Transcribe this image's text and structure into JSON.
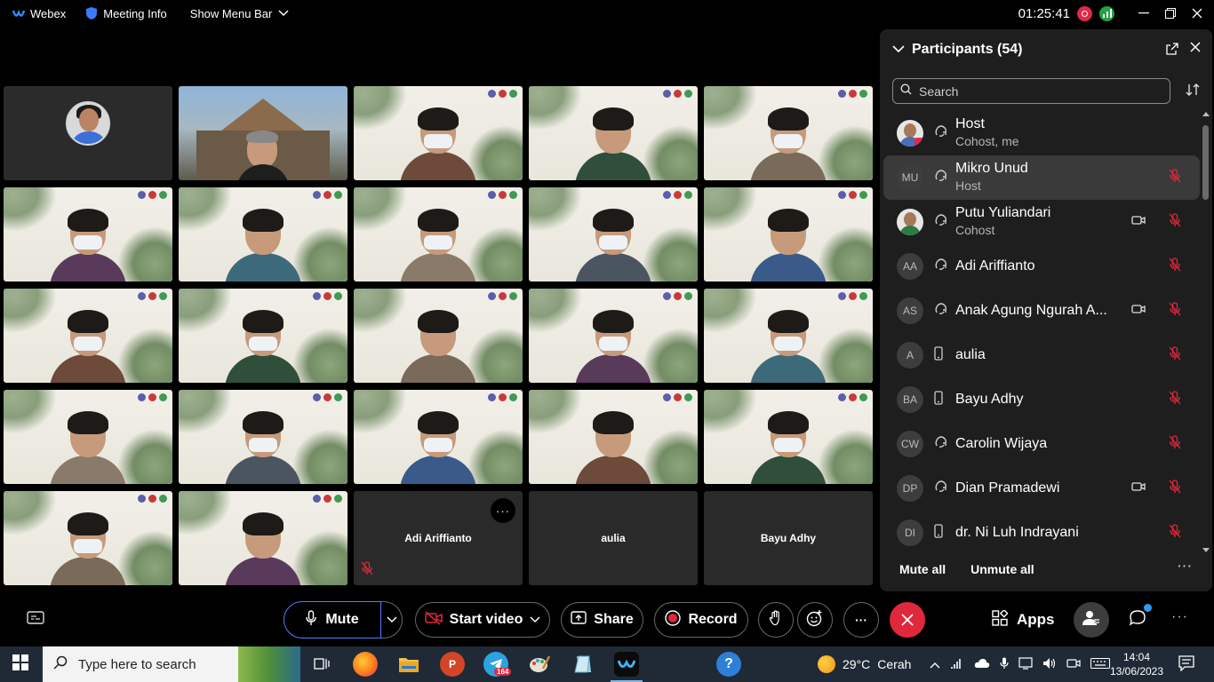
{
  "titlebar": {
    "app_name": "Webex",
    "meeting_info": "Meeting Info",
    "show_menu_bar": "Show Menu Bar",
    "timer": "01:25:41"
  },
  "grid": {
    "tiles": [
      {
        "type": "avatar"
      },
      {
        "type": "building"
      },
      {
        "type": "video"
      },
      {
        "type": "video"
      },
      {
        "type": "video"
      },
      {
        "type": "video"
      },
      {
        "type": "video"
      },
      {
        "type": "video"
      },
      {
        "type": "video"
      },
      {
        "type": "video"
      },
      {
        "type": "video"
      },
      {
        "type": "video"
      },
      {
        "type": "video"
      },
      {
        "type": "video"
      },
      {
        "type": "video"
      },
      {
        "type": "video"
      },
      {
        "type": "video"
      },
      {
        "type": "video"
      },
      {
        "type": "video"
      },
      {
        "type": "video"
      },
      {
        "type": "video"
      },
      {
        "type": "video"
      }
    ],
    "name_tiles": [
      {
        "name": "Adi Ariffianto"
      },
      {
        "name": "aulia"
      },
      {
        "name": "Bayu Adhy"
      }
    ]
  },
  "panel": {
    "title": "Participants (54)",
    "search_placeholder": "Search",
    "participants": [
      {
        "initials": "",
        "name": "Host",
        "role": "Cohost, me",
        "conn": "computer",
        "video": false,
        "muted_icon": false,
        "avatar": "photo"
      },
      {
        "initials": "MU",
        "name": "Mikro Unud",
        "role": "Host",
        "conn": "computer",
        "video": false,
        "muted_icon": true,
        "avatar": "initials"
      },
      {
        "initials": "",
        "name": "Putu Yuliandari",
        "role": "Cohost",
        "conn": "computer",
        "video": true,
        "muted_icon": true,
        "avatar": "photo2"
      },
      {
        "initials": "AA",
        "name": "Adi Ariffianto",
        "role": "",
        "conn": "computer",
        "video": false,
        "muted_icon": true,
        "avatar": "initials"
      },
      {
        "initials": "AS",
        "name": "Anak Agung Ngurah A...",
        "role": "",
        "conn": "computer",
        "video": true,
        "muted_icon": true,
        "avatar": "initials"
      },
      {
        "initials": "A",
        "name": "aulia",
        "role": "",
        "conn": "phone",
        "video": false,
        "muted_icon": true,
        "avatar": "initials"
      },
      {
        "initials": "BA",
        "name": "Bayu Adhy",
        "role": "",
        "conn": "phone",
        "video": false,
        "muted_icon": true,
        "avatar": "initials"
      },
      {
        "initials": "CW",
        "name": "Carolin Wijaya",
        "role": "",
        "conn": "computer",
        "video": false,
        "muted_icon": true,
        "avatar": "initials"
      },
      {
        "initials": "DP",
        "name": "Dian Pramadewi",
        "role": "",
        "conn": "computer",
        "video": true,
        "muted_icon": true,
        "avatar": "initials"
      },
      {
        "initials": "DI",
        "name": "dr. Ni Luh Indrayani",
        "role": "",
        "conn": "phone",
        "video": false,
        "muted_icon": true,
        "avatar": "initials"
      }
    ],
    "mute_all": "Mute all",
    "unmute_all": "Unmute all"
  },
  "toolbar": {
    "mute": "Mute",
    "start_video": "Start video",
    "share": "Share",
    "record": "Record",
    "apps": "Apps"
  },
  "taskbar": {
    "search_placeholder": "Type here to search",
    "telegram_badge": "164",
    "temperature": "29°C",
    "weather": "Cerah",
    "time": "14:04",
    "date": "13/06/2023"
  },
  "colors": {
    "end_call": "#e0283c",
    "mute_border": "#4e7cff",
    "panel_bg": "#1e1e1e",
    "taskbar_bg": "#1f2a36"
  }
}
